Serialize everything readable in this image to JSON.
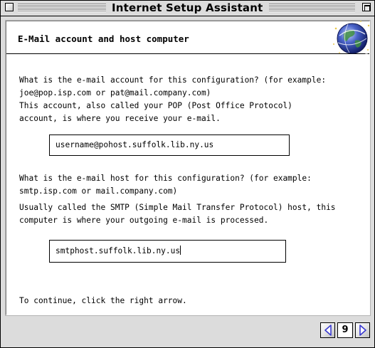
{
  "window": {
    "title": "Internet Setup Assistant"
  },
  "section": {
    "title": "E-Mail account and host computer"
  },
  "account": {
    "question_line1": "What is the e-mail account for this configuration? (for example:",
    "question_line2": "joe@pop.isp.com or pat@mail.company.com)",
    "info_line1": "This account, also called your POP (Post Office Protocol)",
    "info_line2": "account, is where you receive your e-mail.",
    "value": "username@pohost.suffolk.lib.ny.us"
  },
  "host": {
    "question_line1": "What is the e-mail host for this configuration? (for example:",
    "question_line2": "smtp.isp.com or mail.company.com)",
    "info_line1": "Usually called the SMTP (Simple Mail Transfer Protocol) host, this",
    "info_line2": "computer is where your outgoing e-mail is processed.",
    "value": "smtphost.suffolk.lib.ny.us"
  },
  "instructions": {
    "continue": "To continue, click the right arrow."
  },
  "navigation": {
    "page_number": "9",
    "back_icon": "left-arrow-icon",
    "forward_icon": "right-arrow-icon",
    "accent_color": "#3a3ad0"
  }
}
